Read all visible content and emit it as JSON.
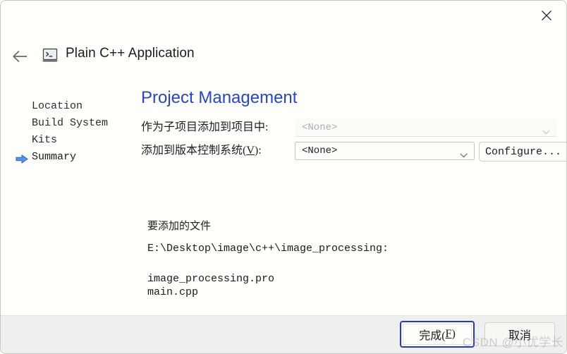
{
  "window": {
    "close_label": "×",
    "bg_color": "#fffffb"
  },
  "header": {
    "title": "Plain C++ Application",
    "icon": "console-app-icon",
    "back_icon": "back-arrow-icon"
  },
  "sidebar": {
    "steps": [
      {
        "label": "Location",
        "current": false
      },
      {
        "label": "Build System",
        "current": false
      },
      {
        "label": "Kits",
        "current": false
      },
      {
        "label": "Summary",
        "current": true
      }
    ],
    "marker_color": "#2a63d8"
  },
  "main": {
    "page_title": "Project Management",
    "page_title_color": "#2543d8",
    "fields": {
      "subproject": {
        "label": "作为子项目添加到项目中:",
        "value": "<None>",
        "enabled": false
      },
      "vcs": {
        "label_pre": "添加到版本控制系统(",
        "label_mnemonic": "V",
        "label_post": "):",
        "value": "<None>",
        "enabled": true
      },
      "configure_button": "Configure..."
    },
    "files": {
      "heading": "要添加的文件",
      "path": "E:\\Desktop\\image\\c++\\image_processing:",
      "items": [
        "image_processing.pro",
        "main.cpp"
      ]
    }
  },
  "footer": {
    "finish_pre": "完成(",
    "finish_mnemonic": "F",
    "finish_post": ")",
    "cancel": "取消",
    "focus_color": "#2438d0"
  },
  "watermark": {
    "text": "CSDN @小优学长"
  }
}
